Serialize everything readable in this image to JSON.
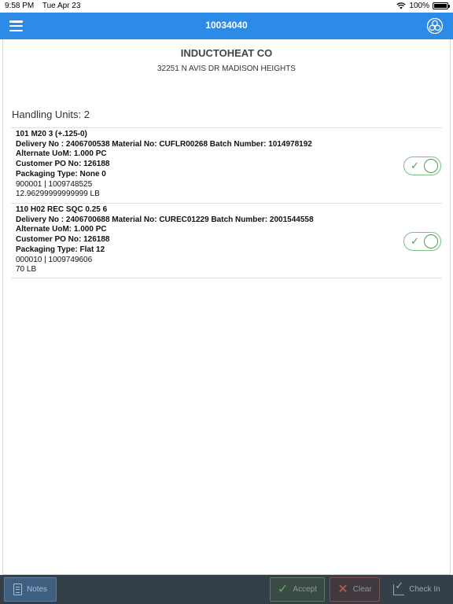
{
  "status_bar": {
    "time": "9:58 PM",
    "date": "Tue Apr 23",
    "battery": "100%"
  },
  "header": {
    "title": "10034040"
  },
  "customer": {
    "name": "INDUCTOHEAT CO",
    "address": "32251 N AVIS DR MADISON HEIGHTS"
  },
  "handling_units": {
    "heading": "Handling Units: 2",
    "items": [
      {
        "title": "101 M20 3 (+.125-0)",
        "delivery": "Delivery No : 2406700538 Material No: CUFLR00268 Batch Number: 1014978192",
        "uom": "Alternate UoM: 1.000 PC",
        "po": "Customer PO No: 126188",
        "packaging": "Packaging Type: None 0",
        "ids": "900001 | 1009748525",
        "weight": "12.96299999999999 LB",
        "checked": true
      },
      {
        "title": "110 H02 REC SQC 0.25 6",
        "delivery": "Delivery No : 2406700688 Material No: CUREC01229 Batch Number: 2001544558",
        "uom": "Alternate UoM: 1.000 PC",
        "po": "Customer PO No: 126188",
        "packaging": "Packaging Type: Flat 12",
        "ids": "000010 | 1009749606",
        "weight": "70 LB",
        "checked": true
      }
    ]
  },
  "toolbar": {
    "notes": "Notes",
    "accept": "Accept",
    "clear": "Clear",
    "check_in": "Check In"
  },
  "icons": {
    "menu": "hamburger-menu-icon",
    "logo": "company-logo-icon",
    "notes": "notes-icon",
    "accept": "check-icon",
    "clear": "x-icon",
    "check_in": "check-in-icon"
  },
  "colors": {
    "header": "#2c8be6",
    "toolbar": "#353f4a",
    "toggle_on": "#4c9f4c"
  }
}
